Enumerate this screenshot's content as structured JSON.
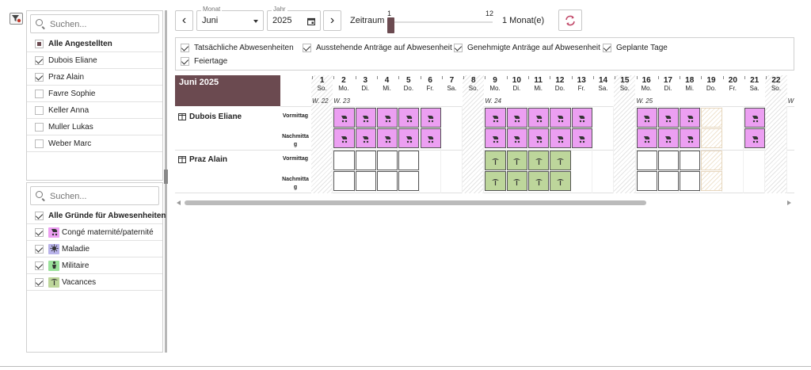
{
  "left": {
    "employees_search_placeholder": "Suchen...",
    "employees": [
      {
        "label": "Alle Angestellten",
        "state": "partial",
        "bold": true
      },
      {
        "label": "Dubois Eliane",
        "state": "on",
        "bold": false
      },
      {
        "label": "Praz Alain",
        "state": "on",
        "bold": false
      },
      {
        "label": "Favre Sophie",
        "state": "off",
        "bold": false
      },
      {
        "label": "Keller Anna",
        "state": "off",
        "bold": false
      },
      {
        "label": "Muller Lukas",
        "state": "off",
        "bold": false
      },
      {
        "label": "Weber Marc",
        "state": "off",
        "bold": false
      }
    ],
    "reasons_search_placeholder": "Suchen...",
    "reasons": [
      {
        "label": "Alle Gründe für Abwesenheiten",
        "state": "on",
        "bold": true,
        "color": "",
        "icon": ""
      },
      {
        "label": "Congé maternité/paternité",
        "state": "on",
        "bold": false,
        "color": "#ec9ff2",
        "icon": "stroller-icon"
      },
      {
        "label": "Maladie",
        "state": "on",
        "bold": false,
        "color": "#b9b3ea",
        "icon": "virus-icon"
      },
      {
        "label": "Militaire",
        "state": "on",
        "bold": false,
        "color": "#9be29b",
        "icon": "soldier-icon"
      },
      {
        "label": "Vacances",
        "state": "on",
        "bold": false,
        "color": "#bdd69b",
        "icon": "palm-icon"
      }
    ]
  },
  "toolbar": {
    "prev": "‹",
    "next": "›",
    "month_label": "Monat",
    "month_value": "Juni",
    "year_label": "Jahr",
    "year_value": "2025",
    "range_label": "Zeitraum",
    "slider_min": "1",
    "slider_max": "12",
    "slider_value": 1,
    "range_value": "1 Monat(e)"
  },
  "options": [
    {
      "label": "Tatsächliche Abwesenheiten",
      "state": "on"
    },
    {
      "label": "Ausstehende Anträge auf Abwesenheit",
      "state": "on"
    },
    {
      "label": "Genehmigte Anträge auf Abwesenheit",
      "state": "on"
    },
    {
      "label": "Geplante Tage",
      "state": "on"
    },
    {
      "label": "Feiertage",
      "state": "on"
    }
  ],
  "calendar": {
    "title": "Juni 2025",
    "title_color": "#6b4a50",
    "days": [
      {
        "d": "1",
        "w": "So."
      },
      {
        "d": "2",
        "w": "Mo."
      },
      {
        "d": "3",
        "w": "Di."
      },
      {
        "d": "4",
        "w": "Mi."
      },
      {
        "d": "5",
        "w": "Do."
      },
      {
        "d": "6",
        "w": "Fr."
      },
      {
        "d": "7",
        "w": "Sa."
      },
      {
        "d": "8",
        "w": "So."
      },
      {
        "d": "9",
        "w": "Mo."
      },
      {
        "d": "10",
        "w": "Di."
      },
      {
        "d": "11",
        "w": "Mi."
      },
      {
        "d": "12",
        "w": "Do."
      },
      {
        "d": "13",
        "w": "Fr."
      },
      {
        "d": "14",
        "w": "Sa."
      },
      {
        "d": "15",
        "w": "So."
      },
      {
        "d": "16",
        "w": "Mo."
      },
      {
        "d": "17",
        "w": "Di."
      },
      {
        "d": "18",
        "w": "Mi."
      },
      {
        "d": "19",
        "w": "Do."
      },
      {
        "d": "20",
        "w": "Fr."
      },
      {
        "d": "21",
        "w": "Sa."
      },
      {
        "d": "22",
        "w": "So."
      }
    ],
    "weeks": [
      {
        "day_index": 0,
        "label": "W. 22"
      },
      {
        "day_index": 1,
        "label": "W. 23"
      },
      {
        "day_index": 8,
        "label": "W. 24"
      },
      {
        "day_index": 15,
        "label": "W. 25"
      },
      {
        "day_index": 22,
        "label": "W"
      }
    ],
    "rows": [
      {
        "name": "Dubois Eliane",
        "slots": [
          {
            "label": "Vormittag",
            "cells": "-PPPPP--PPPPP--PPPE-P--P"
          },
          {
            "label": "Nachmittag",
            "cells": "-PPPPP--PPPPP--PPPE-P--P"
          }
        ]
      },
      {
        "name": "Praz Alain",
        "slots": [
          {
            "label": "Vormittag",
            "cells": "-WWWW---GGGG---WWWE---G"
          },
          {
            "label": "Nachmittag",
            "cells": "-WWWW---GGGG---WWWE---G"
          }
        ]
      }
    ]
  }
}
